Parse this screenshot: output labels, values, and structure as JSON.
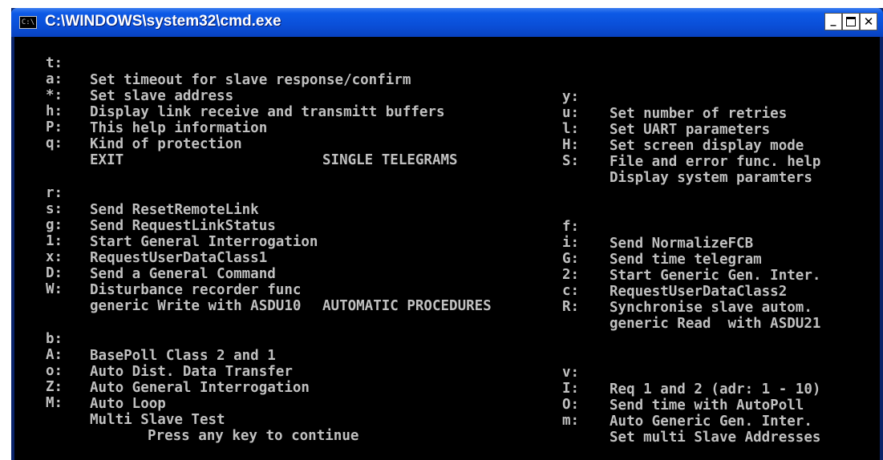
{
  "window": {
    "title": "C:\\WINDOWS\\system32\\cmd.exe",
    "icon_text": "C:\\",
    "minimize_label": "_",
    "close_label": "✕"
  },
  "menu": {
    "options": [
      {
        "key_left": "t:",
        "label_left": "Set timeout for slave response/confirm",
        "key_right": "y:",
        "label_right": "Set number of retries"
      },
      {
        "key_left": "a:",
        "label_left": "Set slave address",
        "key_right": "u:",
        "label_right": "Set UART parameters"
      },
      {
        "key_left": "*:",
        "label_left": "Display link receive and transmitt buffers",
        "key_right": "l:",
        "label_right": "Set screen display mode"
      },
      {
        "key_left": "h:",
        "label_left": "This help information",
        "key_right": "H:",
        "label_right": "File and error func. help"
      },
      {
        "key_left": "P:",
        "label_left": "Kind of protection",
        "key_right": "S:",
        "label_right": "Display system paramters"
      },
      {
        "key_left": "q:",
        "label_left": "EXIT",
        "key_right": "",
        "label_right": ""
      }
    ],
    "single_heading": "SINGLE TELEGRAMS",
    "single": [
      {
        "key_left": "r:",
        "label_left": "Send ResetRemoteLink",
        "key_right": "f:",
        "label_right": "Send NormalizeFCB"
      },
      {
        "key_left": "s:",
        "label_left": "Send RequestLinkStatus",
        "key_right": "i:",
        "label_right": "Send time telegram"
      },
      {
        "key_left": "g:",
        "label_left": "Start General Interrogation",
        "key_right": "G:",
        "label_right": "Start Generic Gen. Inter."
      },
      {
        "key_left": "1:",
        "label_left": "RequestUserDataClass1",
        "key_right": "2:",
        "label_right": "RequestUserDataClass2"
      },
      {
        "key_left": "x:",
        "label_left": "Send a General Command",
        "key_right": "c:",
        "label_right": "Synchronise slave autom."
      },
      {
        "key_left": "D:",
        "label_left": "Disturbance recorder func",
        "key_right": "R:",
        "label_right": "generic Read  with ASDU21"
      },
      {
        "key_left": "W:",
        "label_left": "generic Write with ASDU10",
        "key_right": "",
        "label_right": ""
      }
    ],
    "auto_heading": "AUTOMATIC PROCEDURES",
    "auto": [
      {
        "key_left": "b:",
        "label_left": "BasePoll Class 2 and 1",
        "key_right": "v:",
        "label_right": "Req 1 and 2 (adr: 1 - 10)"
      },
      {
        "key_left": "A:",
        "label_left": "Auto Dist. Data Transfer",
        "key_right": "I:",
        "label_right": "Send time with AutoPoll"
      },
      {
        "key_left": "o:",
        "label_left": "Auto General Interrogation",
        "key_right": "O:",
        "label_right": "Auto Generic Gen. Inter."
      },
      {
        "key_left": "Z:",
        "label_left": "Auto Loop",
        "key_right": "m:",
        "label_right": "Set multi Slave Addresses"
      },
      {
        "key_left": "M:",
        "label_left": "Multi Slave Test",
        "key_right": "",
        "label_right": ""
      }
    ],
    "prompt": "Press any key to continue"
  },
  "colors": {
    "console_bg": "#000000",
    "console_text": "#c0c0c0",
    "titlebar": "#0a4fd8"
  }
}
